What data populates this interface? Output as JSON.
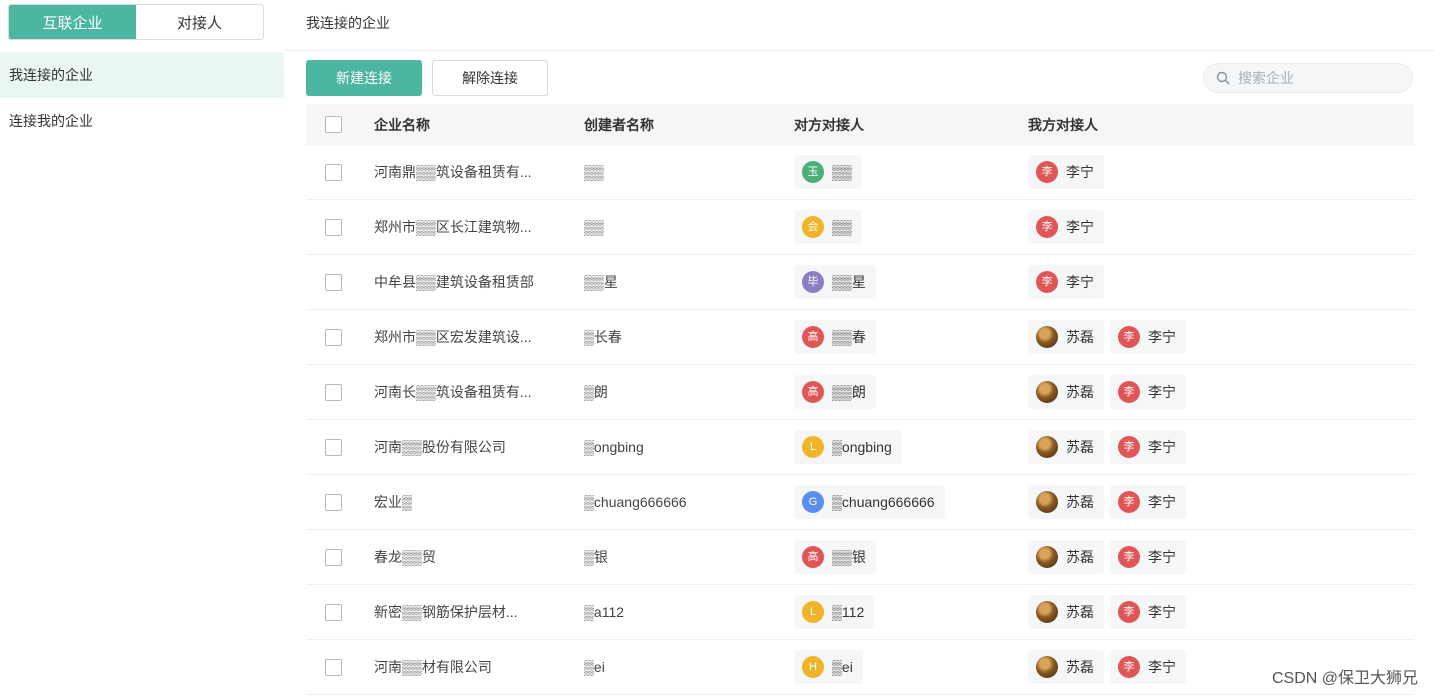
{
  "sidebar": {
    "segments": [
      {
        "label": "互联企业",
        "active": true
      },
      {
        "label": "对接人",
        "active": false
      }
    ],
    "items": [
      {
        "label": "我连接的企业",
        "active": true
      },
      {
        "label": "连接我的企业",
        "active": false
      }
    ]
  },
  "main": {
    "page_title": "我连接的企业",
    "new_button": "新建连接",
    "remove_button": "解除连接",
    "search_placeholder": "搜索企业",
    "columns": [
      "企业名称",
      "创建者名称",
      "对方对接人",
      "我方对接人"
    ]
  },
  "rows": [
    {
      "company": "河南鼎▒▒筑设备租赁有...",
      "creator": "▒▒",
      "peer": {
        "initial": "玉",
        "color": "#4caf78",
        "name": "▒▒"
      },
      "mine": [
        {
          "name": "李宁",
          "initial": "李"
        }
      ]
    },
    {
      "company": "郑州市▒▒区长江建筑物...",
      "creator": "▒▒",
      "peer": {
        "initial": "会",
        "color": "#f0b429",
        "name": "▒▒"
      },
      "mine": [
        {
          "name": "李宁",
          "initial": "李"
        }
      ]
    },
    {
      "company": "中牟县▒▒建筑设备租赁部",
      "creator": "▒▒星",
      "peer": {
        "initial": "毕",
        "color": "#8e7cc3",
        "name": "▒▒星"
      },
      "mine": [
        {
          "name": "李宁",
          "initial": "李"
        }
      ]
    },
    {
      "company": "郑州市▒▒区宏发建筑设...",
      "creator": "▒长春",
      "peer": {
        "initial": "高",
        "color": "#e05555",
        "name": "▒▒春"
      },
      "mine": [
        {
          "name": "苏磊",
          "initial": ""
        },
        {
          "name": "李宁",
          "initial": "李"
        }
      ]
    },
    {
      "company": "河南长▒▒筑设备租赁有...",
      "creator": "▒朗",
      "peer": {
        "initial": "高",
        "color": "#e05555",
        "name": "▒▒朗"
      },
      "mine": [
        {
          "name": "苏磊",
          "initial": ""
        },
        {
          "name": "李宁",
          "initial": "李"
        }
      ]
    },
    {
      "company": "河南▒▒股份有限公司",
      "creator": "▒ongbing",
      "peer": {
        "initial": "L",
        "color": "#f0b429",
        "name": "▒ongbing"
      },
      "mine": [
        {
          "name": "苏磊",
          "initial": ""
        },
        {
          "name": "李宁",
          "initial": "李"
        }
      ]
    },
    {
      "company": "宏业▒",
      "creator": "▒chuang666666",
      "peer": {
        "initial": "G",
        "color": "#5b8def",
        "name": "▒chuang666666"
      },
      "mine": [
        {
          "name": "苏磊",
          "initial": ""
        },
        {
          "name": "李宁",
          "initial": "李"
        }
      ]
    },
    {
      "company": "春龙▒▒贸",
      "creator": "▒银",
      "peer": {
        "initial": "高",
        "color": "#e05555",
        "name": "▒▒银"
      },
      "mine": [
        {
          "name": "苏磊",
          "initial": ""
        },
        {
          "name": "李宁",
          "initial": "李"
        }
      ]
    },
    {
      "company": "新密▒▒钢筋保护层材...",
      "creator": "▒a112",
      "peer": {
        "initial": "L",
        "color": "#f0b429",
        "name": "▒112"
      },
      "mine": [
        {
          "name": "苏磊",
          "initial": ""
        },
        {
          "name": "李宁",
          "initial": "李"
        }
      ]
    },
    {
      "company": "河南▒▒材有限公司",
      "creator": "▒ei",
      "peer": {
        "initial": "H",
        "color": "#f0b429",
        "name": "▒ei"
      },
      "mine": [
        {
          "name": "苏磊",
          "initial": ""
        },
        {
          "name": "李宁",
          "initial": "李"
        }
      ]
    }
  ],
  "mine_avatar_color": "#e05555",
  "accent_color": "#4db6a1",
  "watermark": "CSDN @保卫大狮兄"
}
